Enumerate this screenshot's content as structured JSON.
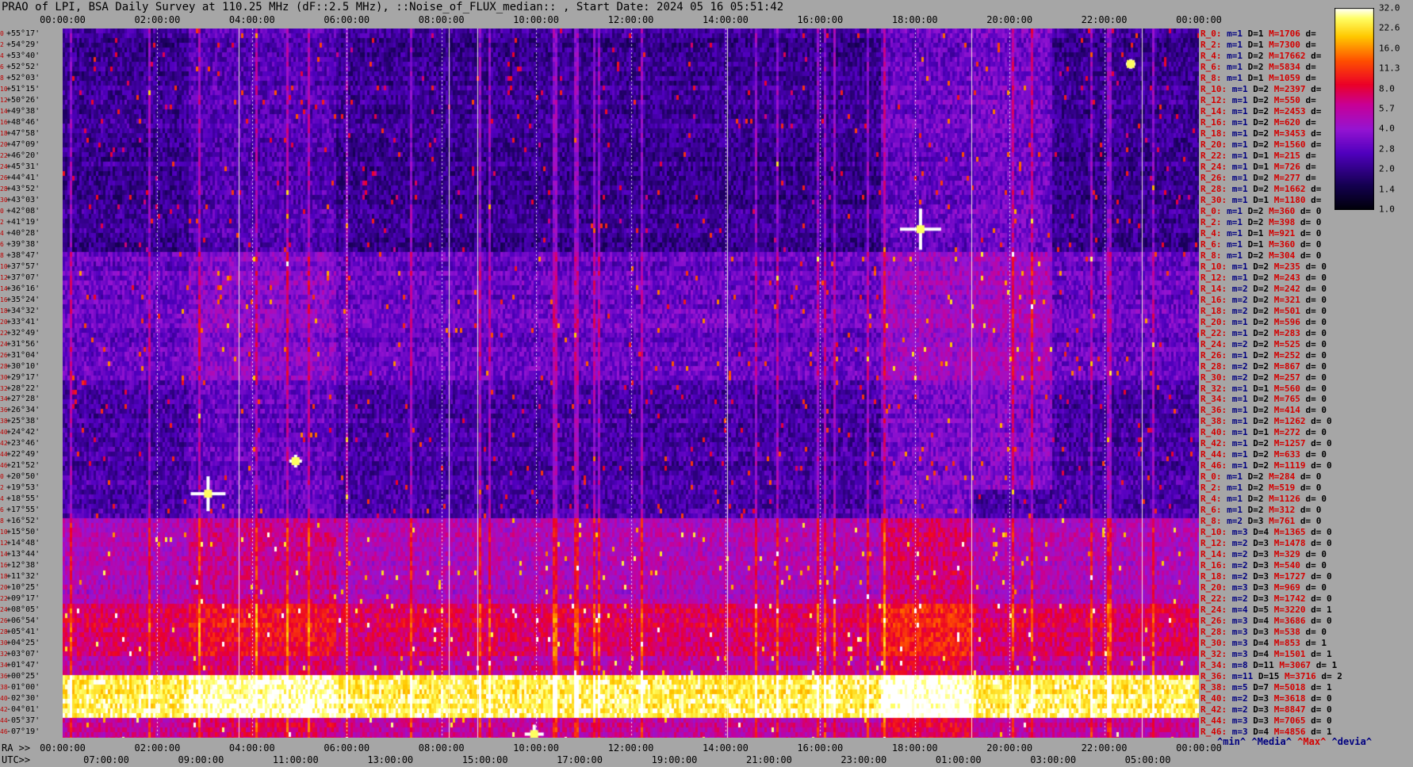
{
  "title": "PRAO of LPI, BSA Daily Survey at 110.25 MHz (dF::2.5 MHz), ::Noise_of_FLUX_median:: , Start Date: 2024 05 16 05:51:42",
  "chart_data": {
    "type": "heatmap",
    "top_axis_ticks": [
      "00:00:00",
      "02:00:00",
      "04:00:00",
      "06:00:00",
      "08:00:00",
      "10:00:00",
      "12:00:00",
      "14:00:00",
      "16:00:00",
      "18:00:00",
      "20:00:00",
      "22:00:00",
      "00:00:00"
    ],
    "ra_axis_prefix": "RA >>",
    "ra_axis_ticks": [
      "00:00:00",
      "02:00:00",
      "04:00:00",
      "06:00:00",
      "08:00:00",
      "10:00:00",
      "12:00:00",
      "14:00:00",
      "16:00:00",
      "18:00:00",
      "20:00:00",
      "22:00:00",
      "00:00:00"
    ],
    "utc_axis_prefix": "UTC>>",
    "utc_axis_ticks": [
      "07:00:00",
      "09:00:00",
      "11:00:00",
      "13:00:00",
      "15:00:00",
      "17:00:00",
      "19:00:00",
      "21:00:00",
      "23:00:00",
      "01:00:00",
      "03:00:00",
      "05:00:00"
    ],
    "declinations": [
      "+55°17'",
      "+54°29'",
      "+53°40'",
      "+52°52'",
      "+52°03'",
      "+51°15'",
      "+50°26'",
      "+49°38'",
      "+48°46'",
      "+47°58'",
      "+47°09'",
      "+46°20'",
      "+45°31'",
      "+44°41'",
      "+43°52'",
      "+43°03'",
      "+42°08'",
      "+41°19'",
      "+40°28'",
      "+39°38'",
      "+38°47'",
      "+37°57'",
      "+37°07'",
      "+36°16'",
      "+35°24'",
      "+34°32'",
      "+33°41'",
      "+32°49'",
      "+31°56'",
      "+31°04'",
      "+30°10'",
      "+29°17'",
      "+28°22'",
      "+27°28'",
      "+26°34'",
      "+25°38'",
      "+24°42'",
      "+23°46'",
      "+22°49'",
      "+21°52'",
      "+20°50'",
      "+19°53'",
      "+18°55'",
      "+17°55'",
      "+16°52'",
      "+15°50'",
      "+14°48'",
      "+13°44'",
      "+12°38'",
      "+11°32'",
      "+10°25'",
      "+09°17'",
      "+08°05'",
      "+06°54'",
      "+05°41'",
      "+04°25'",
      "+03°07'",
      "+01°47'",
      "+00°25'",
      "-01°00'",
      "-02°30'",
      "-04°01'",
      "-05°37'",
      "-07°19'"
    ],
    "dec_indices": [
      "0",
      "2",
      "4",
      "6",
      "8",
      "10",
      "12",
      "14",
      "16",
      "18",
      "20",
      "22",
      "24",
      "26",
      "28",
      "30",
      "0",
      "2",
      "4",
      "6",
      "8",
      "10",
      "12",
      "14",
      "16",
      "18",
      "20",
      "22",
      "24",
      "26",
      "28",
      "30",
      "32",
      "34",
      "36",
      "38",
      "40",
      "42",
      "44",
      "46",
      "0",
      "2",
      "4",
      "6",
      "8",
      "10",
      "12",
      "14",
      "16",
      "18",
      "20",
      "22",
      "24",
      "26",
      "28",
      "30",
      "32",
      "34",
      "36",
      "38",
      "40",
      "42",
      "44",
      "46"
    ],
    "stats": [
      {
        "r": "R_0:",
        "m": "m=1",
        "d": "D=1",
        "h": "M=1706",
        "dev": "d="
      },
      {
        "r": "R_2:",
        "m": "m=1",
        "d": "D=1",
        "h": "M=7300",
        "dev": "d="
      },
      {
        "r": "R_4:",
        "m": "m=1",
        "d": "D=2",
        "h": "M=17662",
        "dev": "d="
      },
      {
        "r": "R_6:",
        "m": "m=1",
        "d": "D=2",
        "h": "M=5834",
        "dev": "d="
      },
      {
        "r": "R_8:",
        "m": "m=1",
        "d": "D=1",
        "h": "M=1059",
        "dev": "d="
      },
      {
        "r": "R_10:",
        "m": "m=1",
        "d": "D=2",
        "h": "M=2397",
        "dev": "d="
      },
      {
        "r": "R_12:",
        "m": "m=1",
        "d": "D=2",
        "h": "M=550",
        "dev": "d="
      },
      {
        "r": "R_14:",
        "m": "m=1",
        "d": "D=2",
        "h": "M=2453",
        "dev": "d="
      },
      {
        "r": "R_16:",
        "m": "m=1",
        "d": "D=2",
        "h": "M=620",
        "dev": "d="
      },
      {
        "r": "R_18:",
        "m": "m=1",
        "d": "D=2",
        "h": "M=3453",
        "dev": "d="
      },
      {
        "r": "R_20:",
        "m": "m=1",
        "d": "D=2",
        "h": "M=1560",
        "dev": "d="
      },
      {
        "r": "R_22:",
        "m": "m=1",
        "d": "D=1",
        "h": "M=215",
        "dev": "d="
      },
      {
        "r": "R_24:",
        "m": "m=1",
        "d": "D=1",
        "h": "M=726",
        "dev": "d="
      },
      {
        "r": "R_26:",
        "m": "m=1",
        "d": "D=2",
        "h": "M=277",
        "dev": "d="
      },
      {
        "r": "R_28:",
        "m": "m=1",
        "d": "D=2",
        "h": "M=1662",
        "dev": "d="
      },
      {
        "r": "R_30:",
        "m": "m=1",
        "d": "D=1",
        "h": "M=1180",
        "dev": "d="
      },
      {
        "r": "R_0:",
        "m": "m=1",
        "d": "D=2",
        "h": "M=360",
        "dev": "d= 0"
      },
      {
        "r": "R_2:",
        "m": "m=1",
        "d": "D=2",
        "h": "M=398",
        "dev": "d= 0"
      },
      {
        "r": "R_4:",
        "m": "m=1",
        "d": "D=1",
        "h": "M=921",
        "dev": "d= 0"
      },
      {
        "r": "R_6:",
        "m": "m=1",
        "d": "D=1",
        "h": "M=360",
        "dev": "d= 0"
      },
      {
        "r": "R_8:",
        "m": "m=1",
        "d": "D=2",
        "h": "M=304",
        "dev": "d= 0"
      },
      {
        "r": "R_10:",
        "m": "m=1",
        "d": "D=2",
        "h": "M=235",
        "dev": "d= 0"
      },
      {
        "r": "R_12:",
        "m": "m=1",
        "d": "D=2",
        "h": "M=243",
        "dev": "d= 0"
      },
      {
        "r": "R_14:",
        "m": "m=2",
        "d": "D=2",
        "h": "M=242",
        "dev": "d= 0"
      },
      {
        "r": "R_16:",
        "m": "m=2",
        "d": "D=2",
        "h": "M=321",
        "dev": "d= 0"
      },
      {
        "r": "R_18:",
        "m": "m=2",
        "d": "D=2",
        "h": "M=501",
        "dev": "d= 0"
      },
      {
        "r": "R_20:",
        "m": "m=1",
        "d": "D=2",
        "h": "M=596",
        "dev": "d= 0"
      },
      {
        "r": "R_22:",
        "m": "m=1",
        "d": "D=2",
        "h": "M=283",
        "dev": "d= 0"
      },
      {
        "r": "R_24:",
        "m": "m=2",
        "d": "D=2",
        "h": "M=525",
        "dev": "d= 0"
      },
      {
        "r": "R_26:",
        "m": "m=1",
        "d": "D=2",
        "h": "M=252",
        "dev": "d= 0"
      },
      {
        "r": "R_28:",
        "m": "m=2",
        "d": "D=2",
        "h": "M=867",
        "dev": "d= 0"
      },
      {
        "r": "R_30:",
        "m": "m=2",
        "d": "D=2",
        "h": "M=257",
        "dev": "d= 0"
      },
      {
        "r": "R_32:",
        "m": "m=1",
        "d": "D=1",
        "h": "M=560",
        "dev": "d= 0"
      },
      {
        "r": "R_34:",
        "m": "m=1",
        "d": "D=2",
        "h": "M=765",
        "dev": "d= 0"
      },
      {
        "r": "R_36:",
        "m": "m=1",
        "d": "D=2",
        "h": "M=414",
        "dev": "d= 0"
      },
      {
        "r": "R_38:",
        "m": "m=1",
        "d": "D=2",
        "h": "M=1262",
        "dev": "d= 0"
      },
      {
        "r": "R_40:",
        "m": "m=1",
        "d": "D=1",
        "h": "M=272",
        "dev": "d= 0"
      },
      {
        "r": "R_42:",
        "m": "m=1",
        "d": "D=2",
        "h": "M=1257",
        "dev": "d= 0"
      },
      {
        "r": "R_44:",
        "m": "m=1",
        "d": "D=2",
        "h": "M=633",
        "dev": "d= 0"
      },
      {
        "r": "R_46:",
        "m": "m=1",
        "d": "D=2",
        "h": "M=1119",
        "dev": "d= 0"
      },
      {
        "r": "R_0:",
        "m": "m=1",
        "d": "D=2",
        "h": "M=284",
        "dev": "d= 0"
      },
      {
        "r": "R_2:",
        "m": "m=1",
        "d": "D=2",
        "h": "M=519",
        "dev": "d= 0"
      },
      {
        "r": "R_4:",
        "m": "m=1",
        "d": "D=2",
        "h": "M=1126",
        "dev": "d= 0"
      },
      {
        "r": "R_6:",
        "m": "m=1",
        "d": "D=2",
        "h": "M=312",
        "dev": "d= 0"
      },
      {
        "r": "R_8:",
        "m": "m=2",
        "d": "D=3",
        "h": "M=761",
        "dev": "d= 0"
      },
      {
        "r": "R_10:",
        "m": "m=3",
        "d": "D=4",
        "h": "M=1365",
        "dev": "d= 0"
      },
      {
        "r": "R_12:",
        "m": "m=2",
        "d": "D=3",
        "h": "M=1478",
        "dev": "d= 0"
      },
      {
        "r": "R_14:",
        "m": "m=2",
        "d": "D=3",
        "h": "M=329",
        "dev": "d= 0"
      },
      {
        "r": "R_16:",
        "m": "m=2",
        "d": "D=3",
        "h": "M=540",
        "dev": "d= 0"
      },
      {
        "r": "R_18:",
        "m": "m=2",
        "d": "D=3",
        "h": "M=1727",
        "dev": "d= 0"
      },
      {
        "r": "R_20:",
        "m": "m=3",
        "d": "D=3",
        "h": "M=969",
        "dev": "d= 0"
      },
      {
        "r": "R_22:",
        "m": "m=2",
        "d": "D=3",
        "h": "M=1742",
        "dev": "d= 0"
      },
      {
        "r": "R_24:",
        "m": "m=4",
        "d": "D=5",
        "h": "M=3220",
        "dev": "d= 1"
      },
      {
        "r": "R_26:",
        "m": "m=3",
        "d": "D=4",
        "h": "M=3686",
        "dev": "d= 0"
      },
      {
        "r": "R_28:",
        "m": "m=3",
        "d": "D=3",
        "h": "M=538",
        "dev": "d= 0"
      },
      {
        "r": "R_30:",
        "m": "m=3",
        "d": "D=4",
        "h": "M=853",
        "dev": "d= 1"
      },
      {
        "r": "R_32:",
        "m": "m=3",
        "d": "D=4",
        "h": "M=1501",
        "dev": "d= 1"
      },
      {
        "r": "R_34:",
        "m": "m=8",
        "d": "D=11",
        "h": "M=3067",
        "dev": "d= 1"
      },
      {
        "r": "R_36:",
        "m": "m=11",
        "d": "D=15",
        "h": "M=3716",
        "dev": "d= 2"
      },
      {
        "r": "R_38:",
        "m": "m=5",
        "d": "D=7",
        "h": "M=5018",
        "dev": "d= 1"
      },
      {
        "r": "R_40:",
        "m": "m=2",
        "d": "D=3",
        "h": "M=3618",
        "dev": "d= 0"
      },
      {
        "r": "R_42:",
        "m": "m=2",
        "d": "D=3",
        "h": "M=8847",
        "dev": "d= 0"
      },
      {
        "r": "R_44:",
        "m": "m=3",
        "d": "D=3",
        "h": "M=7065",
        "dev": "d= 0"
      },
      {
        "r": "R_46:",
        "m": "m=3",
        "d": "D=4",
        "h": "M=4856",
        "dev": "d= 1"
      }
    ],
    "legend_footer": {
      "min": "^min^",
      "median": "^Media^",
      "max": "^Max^",
      "dev": "^devia^"
    },
    "colorbar": {
      "ticks": [
        "32.0",
        "22.6",
        "16.0",
        "11.3",
        "8.0",
        "5.7",
        "4.0",
        "2.8",
        "2.0",
        "1.4",
        "1.0"
      ],
      "scale": "log2",
      "range": [
        1.0,
        32.0
      ]
    },
    "colors": {
      "background": "#a6a6a6",
      "bright_band": "#ffff80",
      "red": "#e00000",
      "purple": "#8000c0",
      "dark": "#100030"
    }
  }
}
